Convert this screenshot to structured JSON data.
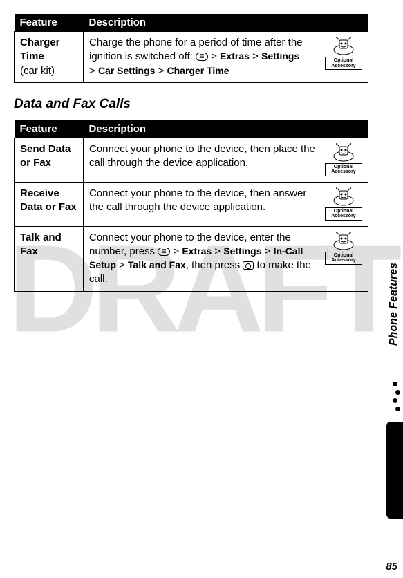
{
  "watermark": "DRAFT",
  "page_number": "85",
  "side_label": "Phone Features",
  "section_heading": "Data and Fax Calls",
  "table1": {
    "headers": [
      "Feature",
      "Description"
    ],
    "rows": [
      {
        "feature_bold": "Charger Time",
        "feature_plain": "(car kit)",
        "desc_pre": "Charge the phone for a period of time after the ignition is switched off: ",
        "path1": "Extras",
        "path2": "Settings",
        "path3": "Car Settings",
        "path4": "Charger Time",
        "accessory": "Optional Accessory"
      }
    ]
  },
  "table2": {
    "headers": [
      "Feature",
      "Description"
    ],
    "rows": [
      {
        "feature_bold": "Send Data or Fax",
        "desc": "Connect your phone to the device, then place the call through the device application.",
        "accessory": "Optional Accessory"
      },
      {
        "feature_bold": "Receive Data or Fax",
        "desc": "Connect your phone to the device, then answer the call through the device application.",
        "accessory": "Optional Accessory"
      },
      {
        "feature_bold": "Talk and Fax",
        "desc_pre": "Connect your phone to the device, enter the number, press ",
        "path1": "Extras",
        "path2": "Settings",
        "path3": "In-Call Setup",
        "path4": "Talk and Fax",
        "desc_post": ", then press ",
        "desc_end": " to make the call.",
        "accessory": "Optional Accessory"
      }
    ]
  }
}
